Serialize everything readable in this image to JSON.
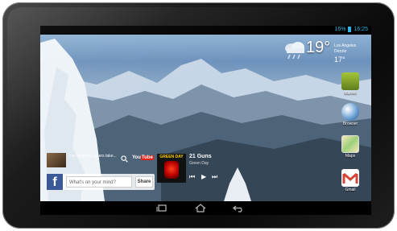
{
  "status": {
    "battery": "16%",
    "time": "16:25"
  },
  "weather": {
    "temperature": "19°",
    "location": "Los Angeles",
    "condition": "Drizzle",
    "low": "17°",
    "icon": "rain-cloud-icon"
  },
  "dock": [
    {
      "label": "Market",
      "icon": "market-icon"
    },
    {
      "label": "Browser",
      "icon": "browser-globe-icon"
    },
    {
      "label": "Maps",
      "icon": "maps-icon"
    },
    {
      "label": "Gmail",
      "icon": "gmail-icon"
    }
  ],
  "youtube": {
    "video_text": "Los Angeles Lakers take...",
    "logo_you": "You",
    "logo_tube": "Tube"
  },
  "facebook": {
    "logo": "f",
    "placeholder": "What's on your mind?",
    "share_label": "Share"
  },
  "music": {
    "album_band": "GREEN DAY",
    "title": "21 Guns",
    "artist": "Green Day"
  },
  "navbar": {
    "back_icon": "back-icon",
    "home_icon": "home-icon",
    "recent_icon": "recent-apps-icon"
  },
  "colors": {
    "accent": "#33b5e5",
    "facebook": "#3b5998",
    "youtube": "#e62117",
    "gmail": "#d44638"
  }
}
